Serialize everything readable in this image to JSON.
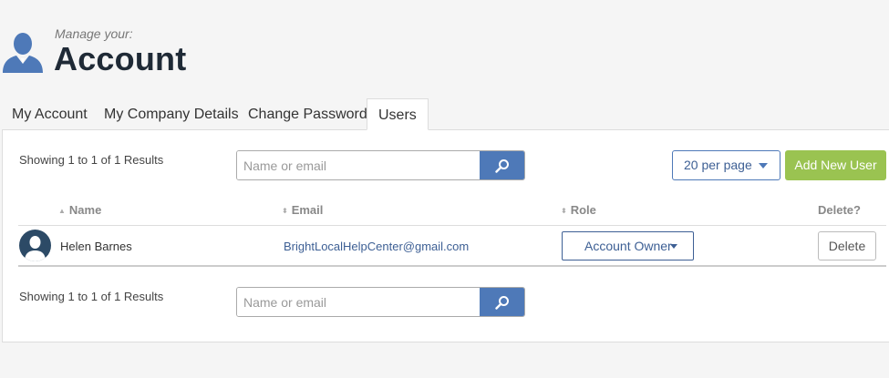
{
  "header": {
    "pre_title": "Manage your:",
    "title": "Account"
  },
  "tabs": [
    {
      "label": "My Account",
      "active": false
    },
    {
      "label": "My Company Details",
      "active": false
    },
    {
      "label": "Change Password",
      "active": false
    },
    {
      "label": "Users",
      "active": true
    }
  ],
  "top_controls": {
    "showing_text": "Showing 1 to 1 of 1 Results",
    "search_placeholder": "Name or email",
    "per_page": "20 per page",
    "add_user_label": "Add New User"
  },
  "table": {
    "columns": [
      "Name",
      "Email",
      "Role",
      "Delete?"
    ],
    "rows": [
      {
        "name": "Helen Barnes",
        "email": "BrightLocalHelpCenter@gmail.com",
        "role": "Account Owner",
        "delete_label": "Delete"
      }
    ]
  },
  "bottom_controls": {
    "showing_text": "Showing 1 to 1 of 1 Results",
    "search_placeholder": "Name or email"
  },
  "colors": {
    "primary": "#4e79b8",
    "add_button": "#9ac351",
    "avatar": "#2c4a66"
  },
  "icons": [
    "user-silhouette-icon",
    "search-icon",
    "chevron-down-icon",
    "sort-icon",
    "user-avatar-icon"
  ]
}
